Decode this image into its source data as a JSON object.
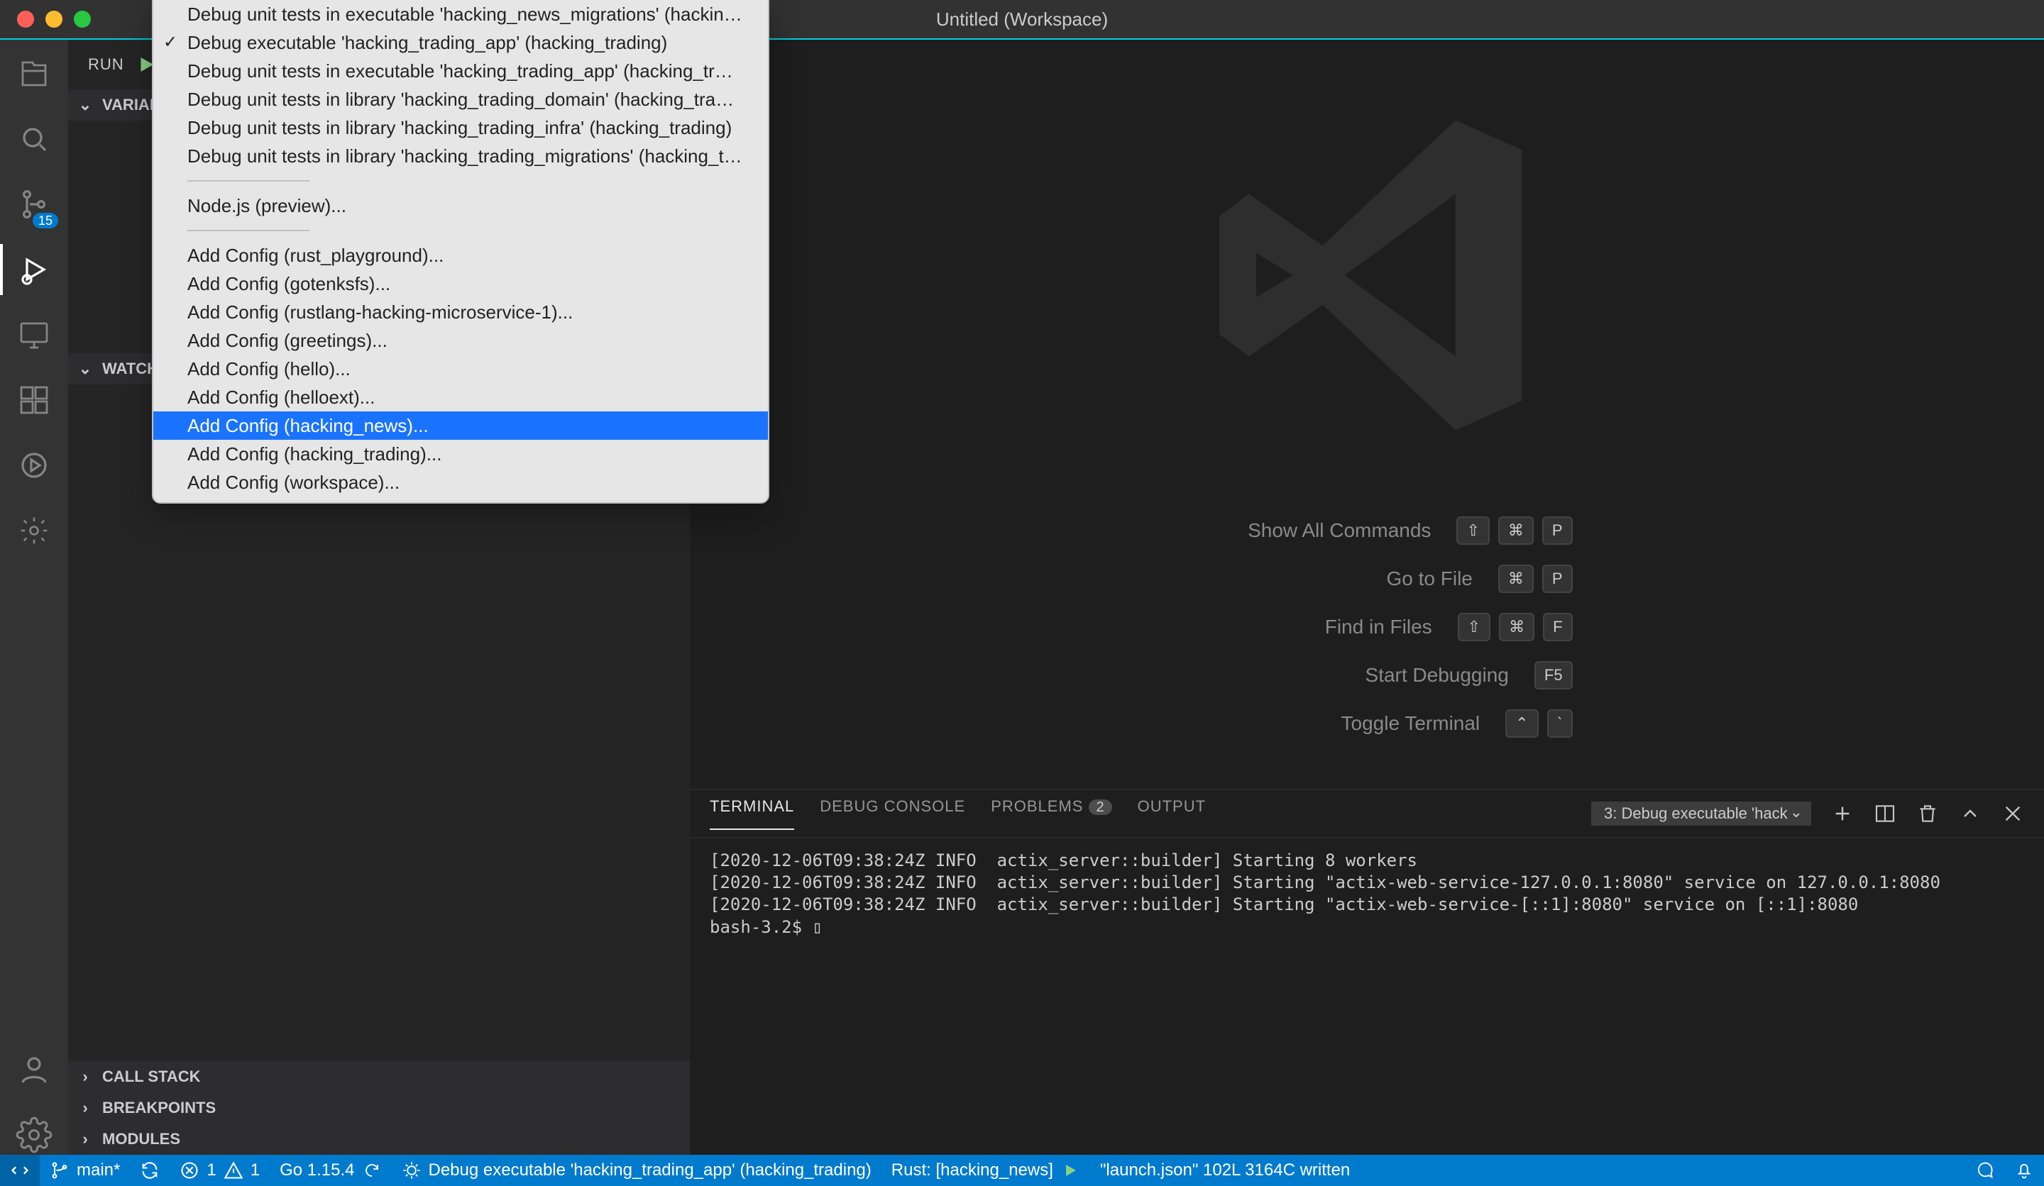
{
  "window": {
    "title": "Untitled (Workspace)"
  },
  "activity": {
    "scm_badge": "15"
  },
  "run_panel": {
    "label": "RUN",
    "sections": {
      "variables": "VARIABLES",
      "watch": "WATCH",
      "callstack": "CALL STACK",
      "breakpoints": "BREAKPOINTS",
      "modules": "MODULES"
    }
  },
  "dropdown": {
    "group1": [
      "Debug unit tests in executable 'hacking_news_migrations' (hacking_news)",
      "Debug executable 'hacking_trading_app' (hacking_trading)",
      "Debug unit tests in executable 'hacking_trading_app' (hacking_trading)",
      "Debug unit tests in library 'hacking_trading_domain' (hacking_trading)",
      "Debug unit tests in library 'hacking_trading_infra' (hacking_trading)",
      "Debug unit tests in library 'hacking_trading_migrations' (hacking_trading)"
    ],
    "group2": [
      "Node.js (preview)..."
    ],
    "group3": [
      "Add Config (rust_playground)...",
      "Add Config (gotenksfs)...",
      "Add Config (rustlang-hacking-microservice-1)...",
      "Add Config (greetings)...",
      "Add Config (hello)...",
      "Add Config (helloext)...",
      "Add Config (hacking_news)...",
      "Add Config (hacking_trading)...",
      "Add Config (workspace)..."
    ],
    "checked_index_g1": 1,
    "selected_index_g3": 6
  },
  "watermark": {
    "rows": [
      {
        "label": "Show All Commands",
        "keys": [
          "⇧",
          "⌘",
          "P"
        ]
      },
      {
        "label": "Go to File",
        "keys": [
          "⌘",
          "P"
        ]
      },
      {
        "label": "Find in Files",
        "keys": [
          "⇧",
          "⌘",
          "F"
        ]
      },
      {
        "label": "Start Debugging",
        "keys": [
          "F5"
        ]
      },
      {
        "label": "Toggle Terminal",
        "keys": [
          "⌃",
          "`"
        ]
      }
    ]
  },
  "panel": {
    "tabs": {
      "terminal": "TERMINAL",
      "debug": "DEBUG CONSOLE",
      "problems": "PROBLEMS",
      "problems_count": "2",
      "output": "OUTPUT"
    },
    "term_dd": "3: Debug executable 'hack",
    "body": "[2020-12-06T09:38:24Z INFO  actix_server::builder] Starting 8 workers\n[2020-12-06T09:38:24Z INFO  actix_server::builder] Starting \"actix-web-service-127.0.0.1:8080\" service on 127.0.0.1:8080\n[2020-12-06T09:38:24Z INFO  actix_server::builder] Starting \"actix-web-service-[::1]:8080\" service on [::1]:8080\nbash-3.2$ ▯"
  },
  "status": {
    "remote": "",
    "branch": "main*",
    "errors": "1",
    "warnings": "1",
    "go": "Go 1.15.4",
    "debug_cfg": "Debug executable 'hacking_trading_app' (hacking_trading)",
    "rust": "Rust: [hacking_news]",
    "msg": "\"launch.json\" 102L 3164C written"
  }
}
